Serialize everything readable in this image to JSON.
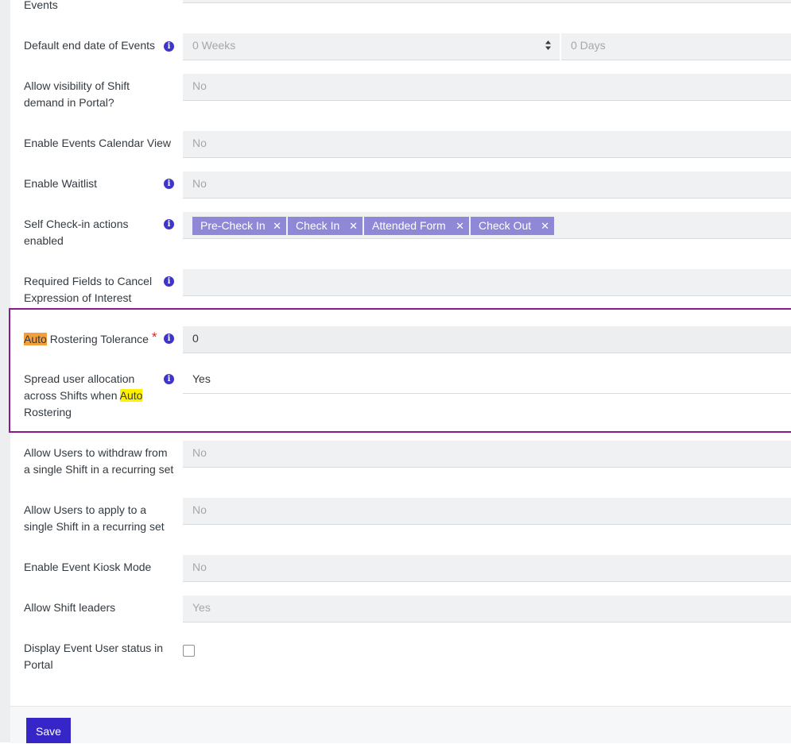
{
  "rows": {
    "events_top": {
      "label": "Events"
    },
    "default_end": {
      "label": "Default end date of Events",
      "weeks": "0 Weeks",
      "days": "0 Days"
    },
    "shift_demand": {
      "label": "Allow visibility of Shift demand in Portal?",
      "value": "No"
    },
    "calendar_view": {
      "label": "Enable Events Calendar View",
      "value": "No"
    },
    "waitlist": {
      "label": "Enable Waitlist",
      "value": "No"
    },
    "self_checkin": {
      "label": "Self Check-in actions enabled",
      "tags": [
        "Pre-Check In",
        "Check In",
        "Attended Form",
        "Check Out"
      ]
    },
    "required_fields": {
      "label": "Required Fields to Cancel Expression of Interest",
      "value": ""
    },
    "auto_rostering": {
      "label_hl": "Auto",
      "label_rest": "Rostering Tolerance",
      "star": "*",
      "value": "0"
    },
    "spread_allocation": {
      "label_pre": "Spread user allocation across Shifts when",
      "label_hl": "Auto",
      "label_post": "Rostering",
      "value": "Yes"
    },
    "withdraw_single": {
      "label": "Allow Users to withdraw from a single Shift in a recurring set",
      "value": "No"
    },
    "apply_single": {
      "label": "Allow Users to apply to a single Shift in a recurring set",
      "value": "No"
    },
    "kiosk_mode": {
      "label": "Enable Event Kiosk Mode",
      "value": "No"
    },
    "shift_leaders": {
      "label": "Allow Shift leaders",
      "value": "Yes"
    },
    "display_status": {
      "label": "Display Event User status in Portal",
      "checked": false
    }
  },
  "footer": {
    "save_label": "Save"
  },
  "icons": {
    "info": "info-circle-icon",
    "remove": "close-icon",
    "select": "sort-arrows-icon"
  },
  "colors": {
    "accent": "#3626c7",
    "tag": "#8e88d6",
    "highlight_box": "#8a1a8e"
  }
}
